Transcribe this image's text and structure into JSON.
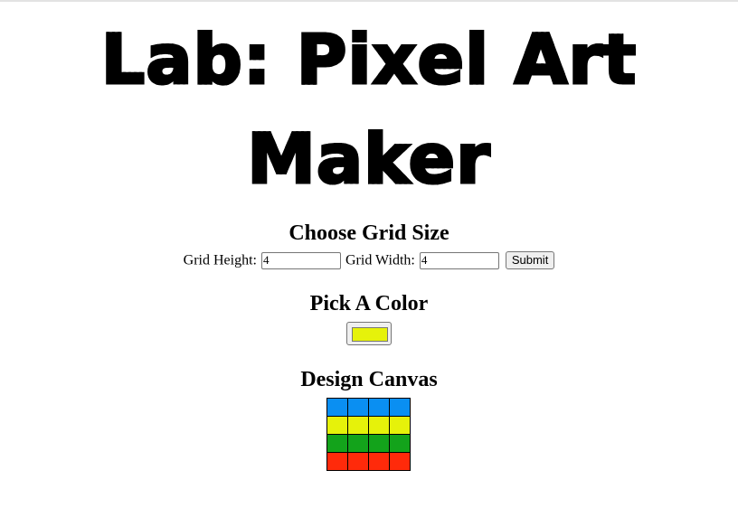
{
  "title": {
    "line1": "Lab: Pixel Art",
    "line2": "Maker"
  },
  "grid_size": {
    "heading": "Choose Grid Size",
    "height_label": "Grid Height:",
    "height_value": "4",
    "width_label": "Grid Width:",
    "width_value": "4",
    "submit_label": "Submit"
  },
  "color": {
    "heading": "Pick A Color",
    "selected": "#e6f20a"
  },
  "canvas": {
    "heading": "Design Canvas",
    "rows": [
      [
        "#0a8ff2",
        "#0a8ff2",
        "#0a8ff2",
        "#0a8ff2"
      ],
      [
        "#e6f20a",
        "#e6f20a",
        "#e6f20a",
        "#e6f20a"
      ],
      [
        "#13a31b",
        "#13a31b",
        "#13a31b",
        "#13a31b"
      ],
      [
        "#ff2a0a",
        "#ff2a0a",
        "#ff2a0a",
        "#ff2a0a"
      ]
    ]
  }
}
